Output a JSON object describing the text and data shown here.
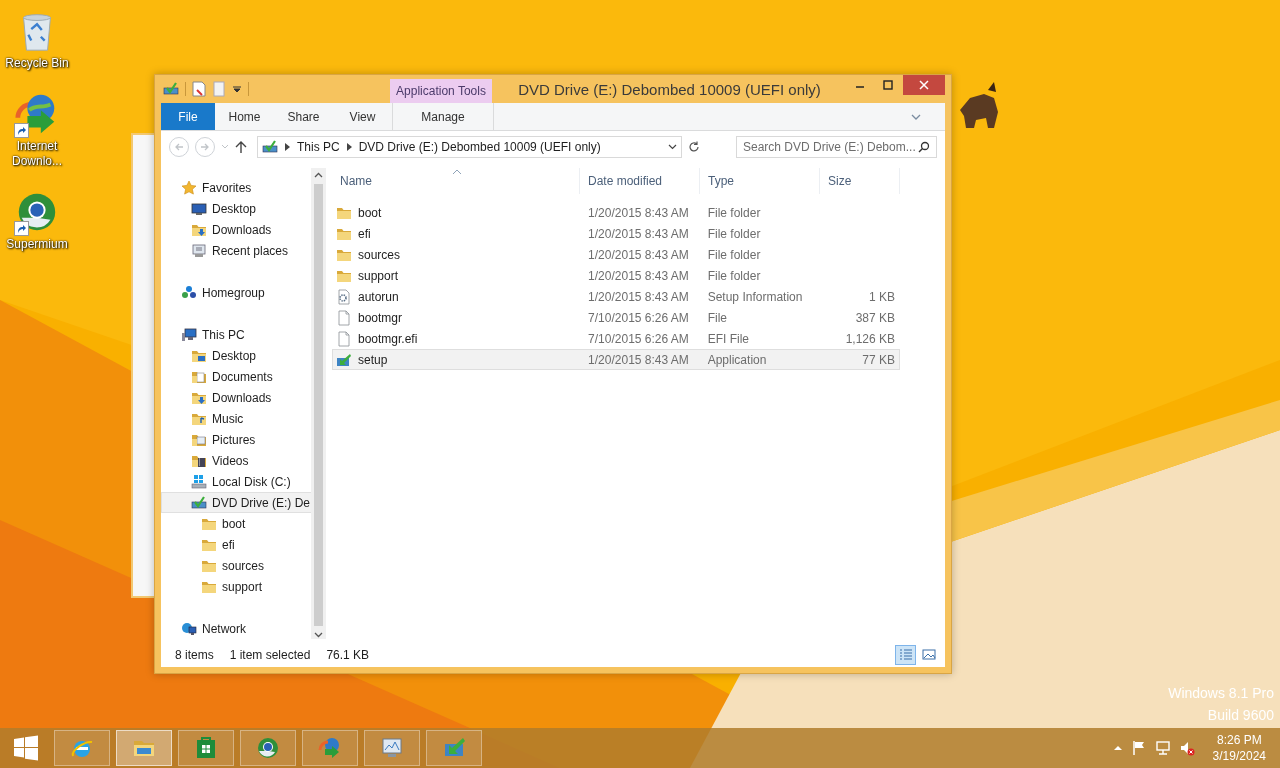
{
  "desktop_icons": [
    {
      "kind": "recycle-bin",
      "label": "Recycle Bin"
    },
    {
      "kind": "globe-arrow",
      "label": "Internet Downlo..."
    },
    {
      "kind": "browser",
      "label": "Supermium"
    }
  ],
  "window": {
    "title": "DVD Drive (E:) Debombed 10009 (UEFI only)",
    "context_group": "Application Tools",
    "ribbon_tabs": [
      {
        "label": "File",
        "kind": "file",
        "selected": false
      },
      {
        "label": "Home",
        "kind": "tab",
        "selected": false
      },
      {
        "label": "Share",
        "kind": "tab",
        "selected": false
      },
      {
        "label": "View",
        "kind": "tab",
        "selected": false
      },
      {
        "label": "Manage",
        "kind": "context",
        "selected": false
      }
    ],
    "address": {
      "crumbs": [
        "This PC",
        "DVD Drive (E:) Debombed 10009 (UEFI only)"
      ]
    },
    "search": {
      "placeholder": "Search DVD Drive (E:) Debom..."
    },
    "navigation": [
      {
        "label": "Favorites",
        "kind": "star",
        "selected": false,
        "children": [
          {
            "label": "Desktop",
            "kind": "desktop",
            "selected": false
          },
          {
            "label": "Downloads",
            "kind": "downloads",
            "selected": false
          },
          {
            "label": "Recent places",
            "kind": "recent",
            "selected": false
          }
        ]
      },
      {
        "label": "Homegroup",
        "kind": "homegroup",
        "selected": false
      },
      {
        "label": "This PC",
        "kind": "pc",
        "selected": false,
        "children": [
          {
            "label": "Desktop",
            "kind": "desktop-folder",
            "selected": false
          },
          {
            "label": "Documents",
            "kind": "documents",
            "selected": false
          },
          {
            "label": "Downloads",
            "kind": "downloads",
            "selected": false
          },
          {
            "label": "Music",
            "kind": "music",
            "selected": false
          },
          {
            "label": "Pictures",
            "kind": "pictures",
            "selected": false
          },
          {
            "label": "Videos",
            "kind": "videos",
            "selected": false
          },
          {
            "label": "Local Disk (C:)",
            "kind": "disk",
            "selected": false
          },
          {
            "label": "DVD Drive (E:) De",
            "kind": "dvd",
            "selected": true,
            "children": [
              {
                "label": "boot",
                "kind": "folder",
                "selected": false
              },
              {
                "label": "efi",
                "kind": "folder",
                "selected": false
              },
              {
                "label": "sources",
                "kind": "folder",
                "selected": false
              },
              {
                "label": "support",
                "kind": "folder",
                "selected": false
              }
            ]
          }
        ]
      },
      {
        "label": "Network",
        "kind": "network",
        "selected": false
      }
    ],
    "columns": [
      "Name",
      "Date modified",
      "Type",
      "Size"
    ],
    "rows": [
      {
        "name": "boot",
        "date": "1/20/2015 8:43 AM",
        "type": "File folder",
        "size": "",
        "kind": "folder",
        "selected": false
      },
      {
        "name": "efi",
        "date": "1/20/2015 8:43 AM",
        "type": "File folder",
        "size": "",
        "kind": "folder",
        "selected": false
      },
      {
        "name": "sources",
        "date": "1/20/2015 8:43 AM",
        "type": "File folder",
        "size": "",
        "kind": "folder",
        "selected": false
      },
      {
        "name": "support",
        "date": "1/20/2015 8:43 AM",
        "type": "File folder",
        "size": "",
        "kind": "folder",
        "selected": false
      },
      {
        "name": "autorun",
        "date": "1/20/2015 8:43 AM",
        "type": "Setup Information",
        "size": "1 KB",
        "kind": "ini",
        "selected": false
      },
      {
        "name": "bootmgr",
        "date": "7/10/2015 6:26 AM",
        "type": "File",
        "size": "387 KB",
        "kind": "file",
        "selected": false
      },
      {
        "name": "bootmgr.efi",
        "date": "7/10/2015 6:26 AM",
        "type": "EFI File",
        "size": "1,126 KB",
        "kind": "file",
        "selected": false
      },
      {
        "name": "setup",
        "date": "1/20/2015 8:43 AM",
        "type": "Application",
        "size": "77 KB",
        "kind": "app",
        "selected": true
      }
    ],
    "status_bar": {
      "count": "8 items",
      "selection": "1 item selected",
      "size": "76.1 KB"
    },
    "view_buttons": [
      {
        "kind": "details",
        "selected": true
      },
      {
        "kind": "thumbnails",
        "selected": false
      }
    ]
  },
  "edition_text": [
    "Windows 8.1 Pro",
    "Build 9600"
  ],
  "taskbar": {
    "items": [
      {
        "kind": "ie",
        "active": false
      },
      {
        "kind": "explorer",
        "active": true
      },
      {
        "kind": "store",
        "active": false
      },
      {
        "kind": "browser",
        "active": false
      },
      {
        "kind": "globe-arrow",
        "active": false
      },
      {
        "kind": "monitor",
        "active": false
      },
      {
        "kind": "app",
        "active": false
      }
    ],
    "clock": {
      "time": "8:26 PM",
      "date": "3/19/2024"
    }
  }
}
